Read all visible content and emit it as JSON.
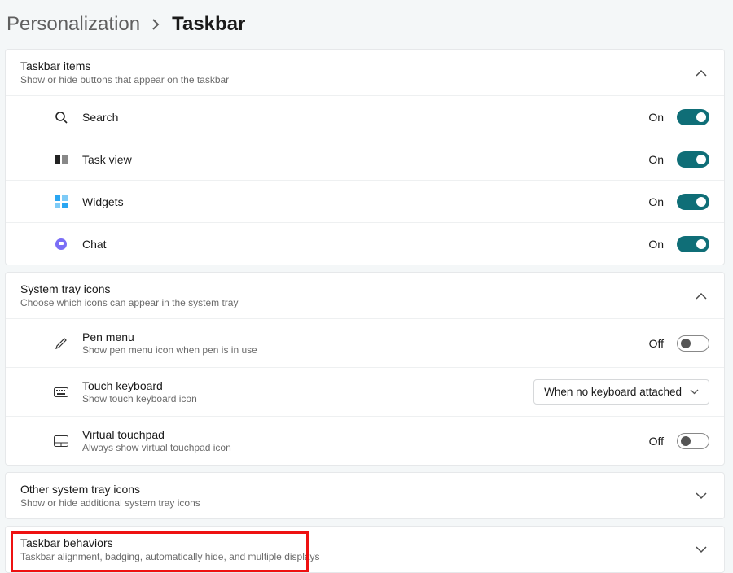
{
  "breadcrumb": {
    "parent": "Personalization",
    "current": "Taskbar"
  },
  "sections": {
    "items": {
      "title": "Taskbar items",
      "subtitle": "Show or hide buttons that appear on the taskbar",
      "rows": [
        {
          "icon": "search-icon",
          "label": "Search",
          "state": "On",
          "toggle": "on"
        },
        {
          "icon": "taskview-icon",
          "label": "Task view",
          "state": "On",
          "toggle": "on"
        },
        {
          "icon": "widgets-icon",
          "label": "Widgets",
          "state": "On",
          "toggle": "on"
        },
        {
          "icon": "chat-icon",
          "label": "Chat",
          "state": "On",
          "toggle": "on"
        }
      ]
    },
    "tray": {
      "title": "System tray icons",
      "subtitle": "Choose which icons can appear in the system tray",
      "rows": [
        {
          "icon": "pen-icon",
          "label": "Pen menu",
          "sublabel": "Show pen menu icon when pen is in use",
          "state": "Off",
          "toggle": "off"
        },
        {
          "icon": "keyboard-icon",
          "label": "Touch keyboard",
          "sublabel": "Show touch keyboard icon",
          "dropdown": "When no keyboard attached"
        },
        {
          "icon": "touchpad-icon",
          "label": "Virtual touchpad",
          "sublabel": "Always show virtual touchpad icon",
          "state": "Off",
          "toggle": "off"
        }
      ]
    },
    "other": {
      "title": "Other system tray icons",
      "subtitle": "Show or hide additional system tray icons"
    },
    "behaviors": {
      "title": "Taskbar behaviors",
      "subtitle": "Taskbar alignment, badging, automatically hide, and multiple displays"
    }
  }
}
